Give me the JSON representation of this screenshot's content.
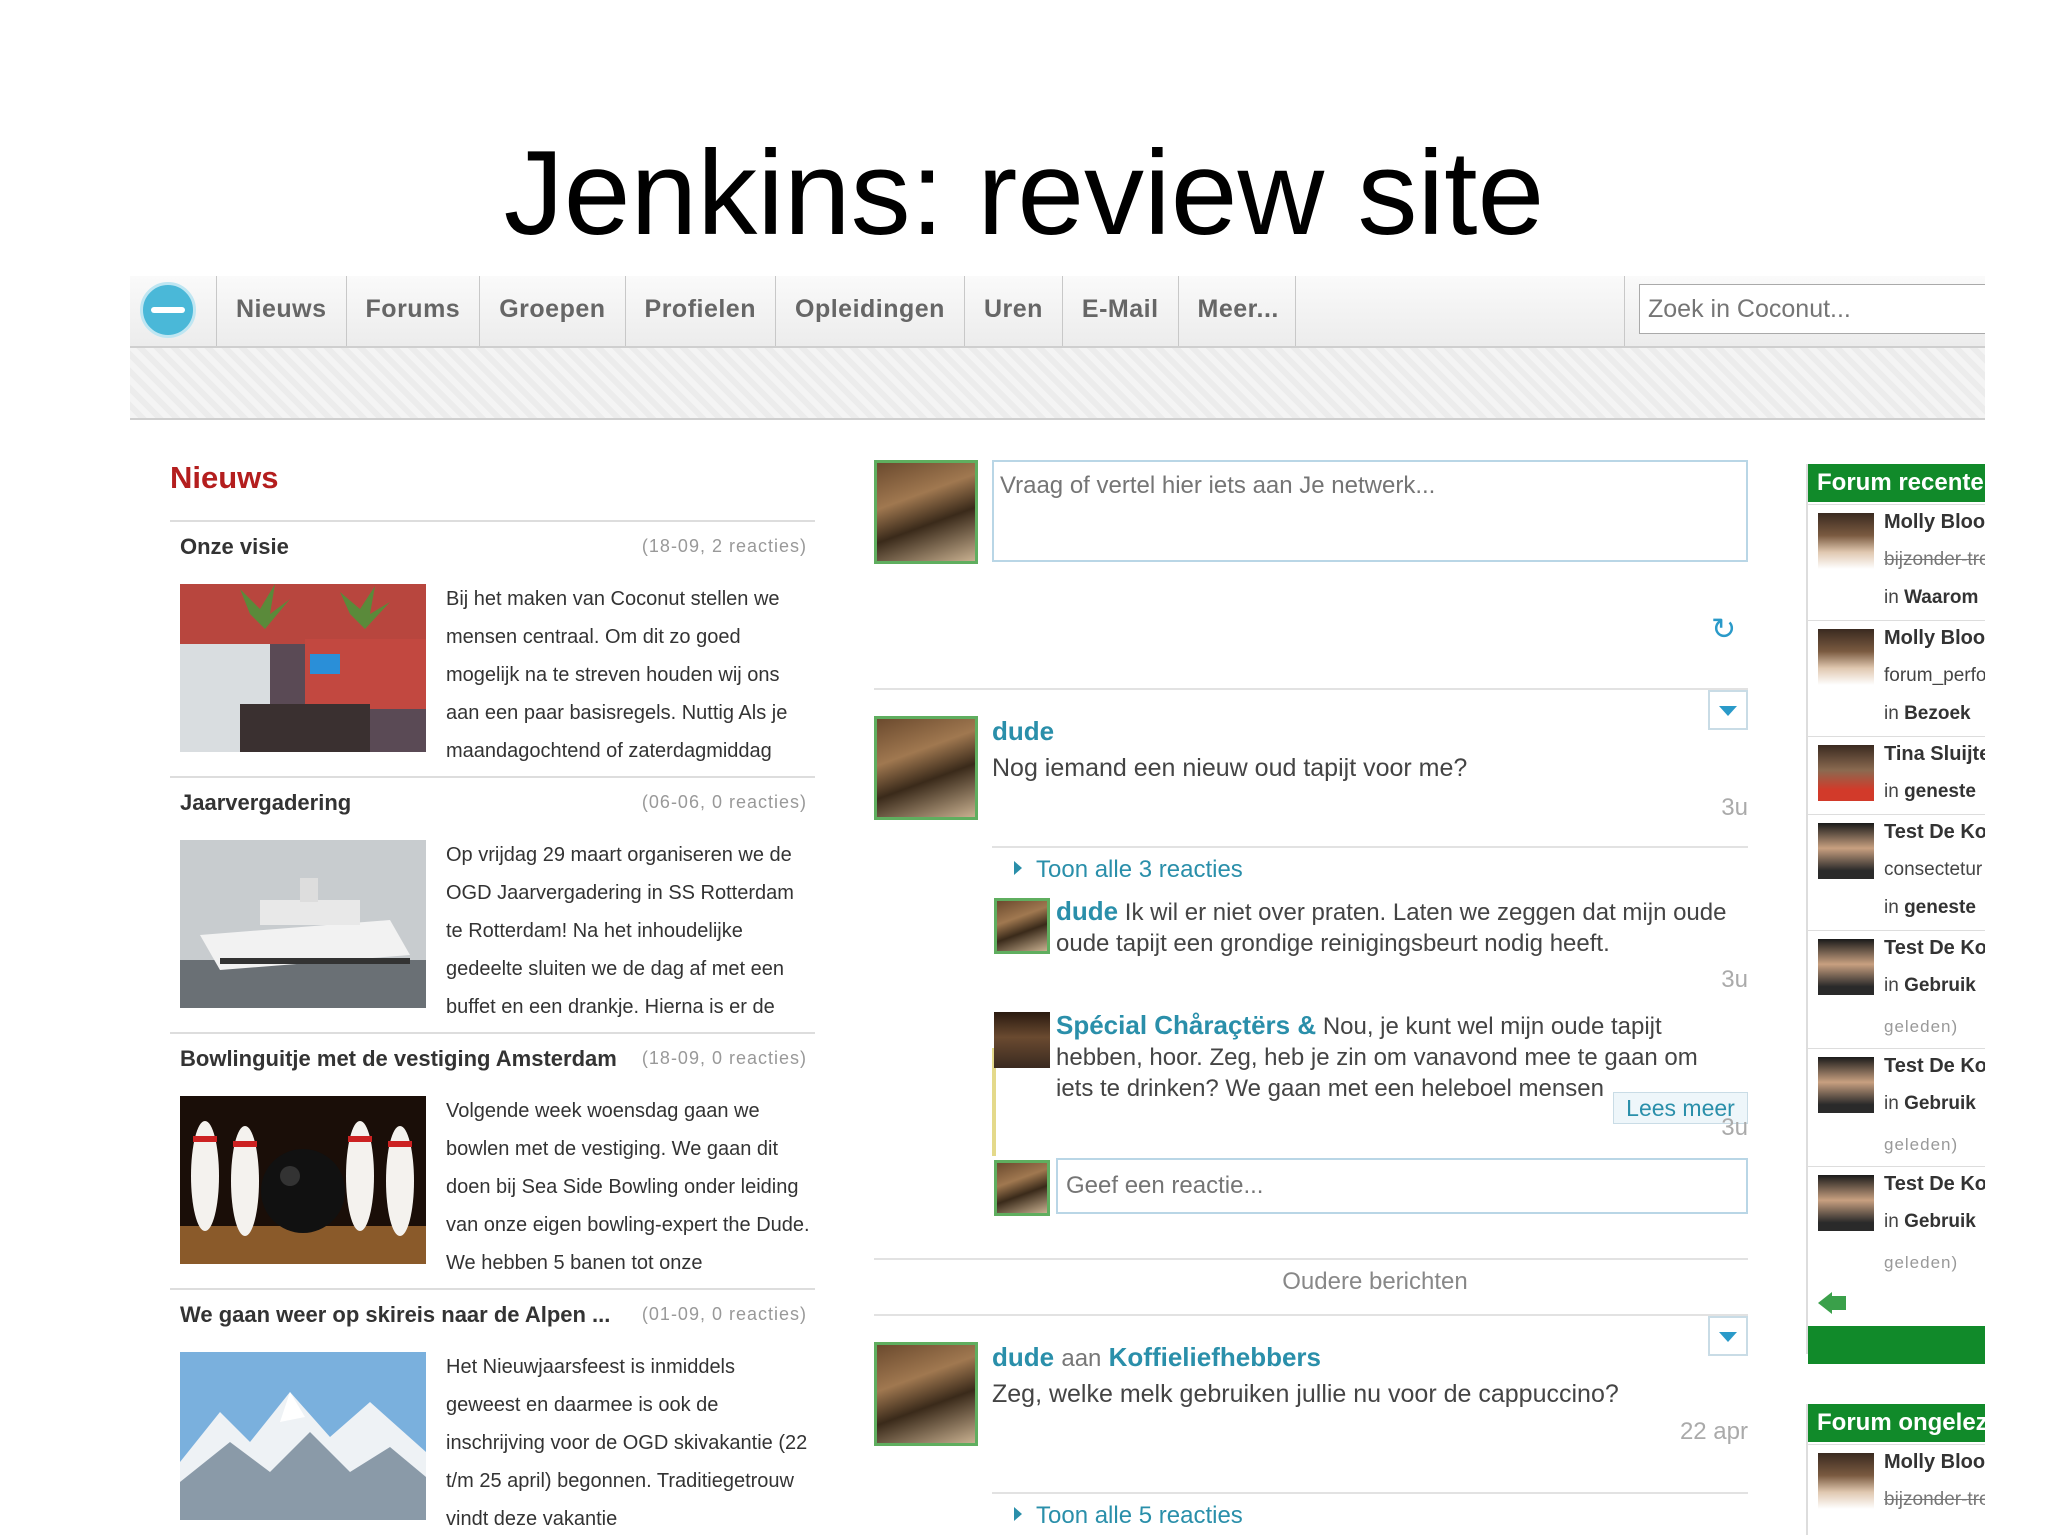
{
  "slide": {
    "title": "Jenkins: review site"
  },
  "nav": {
    "items": [
      "Nieuws",
      "Forums",
      "Groepen",
      "Profielen",
      "Opleidingen",
      "Uren",
      "E-Mail",
      "Meer..."
    ],
    "search_placeholder": "Zoek in Coconut..."
  },
  "news": {
    "title": "Nieuws",
    "items": [
      {
        "title": "Onze visie",
        "meta": "(18-09, 2 reacties)",
        "text": "Bij het maken van Coconut stellen we mensen centraal. Om dit zo goed mogelijk na te streven houden wij ons aan een paar basisregels. Nuttig Als je maandagochtend of zaterdagmiddag"
      },
      {
        "title": "Jaarvergadering",
        "meta": "(06-06, 0 reacties)",
        "text": "Op vrijdag 29 maart organiseren we de OGD Jaarvergadering in SS Rotterdam te Rotterdam! Na het inhoudelijke gedeelte sluiten we de dag af met een buffet en een drankje. Hierna is er de"
      },
      {
        "title": "Bowlinguitje met de vestiging Amsterdam",
        "meta": "(18-09, 0 reacties)",
        "text": "Volgende week woensdag gaan we bowlen met de vestiging. We gaan dit doen bij Sea Side Bowling onder leiding van onze eigen bowling-expert the Dude. We hebben 5 banen tot onze"
      },
      {
        "title": "We gaan weer op skireis naar de Alpen ...",
        "meta": "(01-09, 0 reacties)",
        "text": "Het Nieuwjaarsfeest is inmiddels geweest en daarmee is ook de inschrijving voor de OGD skivakantie (22 t/m 25 april) begonnen. Traditiegetrouw vindt deze vakantie"
      }
    ]
  },
  "feed": {
    "input_placeholder": "Vraag of vertel hier iets aan Je netwerk...",
    "post1": {
      "author": "dude",
      "message": "Nog iemand een nieuw oud tapijt voor me?",
      "time": "3u",
      "toggle": "Toon alle 3 reacties",
      "reply1": {
        "author": "dude",
        "text": "Ik wil er niet over praten. Laten we zeggen dat mijn oude oude tapijt een grondige reinigingsbeurt nodig heeft.",
        "time": "3u"
      },
      "reply2": {
        "author": "Spécial Chåraçtërs &",
        "text": "Nou, je kunt wel mijn oude tapijt hebben, hoor. Zeg, heb je zin om vanavond mee te gaan om iets te drinken? We gaan met een heleboel mensen",
        "more": "Lees meer",
        "time": "3u"
      },
      "reply_placeholder": "Geef een reactie..."
    },
    "older": "Oudere berichten",
    "post2": {
      "author": "dude",
      "connector": "aan",
      "group": "Koffieliefhebbers",
      "message": "Zeg, welke melk gebruiken jullie nu voor de cappuccino?",
      "time": "22 apr",
      "toggle": "Toon alle 5 reacties"
    }
  },
  "forum": {
    "recent_title": "Forum recente",
    "entries": [
      {
        "name": "Molly Bloo",
        "line1": "bijzonder-tre",
        "line1_strike": true,
        "prefix": "in",
        "place": "Waarom"
      },
      {
        "name": "Molly Bloo",
        "line1": "forum_perfo",
        "prefix": "in",
        "place": "Bezoek"
      },
      {
        "name": "Tina Sluijte",
        "prefix": "in",
        "place": "geneste"
      },
      {
        "name": "Test De Ko",
        "line1": "consectetur",
        "prefix": "in",
        "place": "geneste"
      },
      {
        "name": "Test De Ko",
        "prefix": "in",
        "place": "Gebruik",
        "small": "geleden)"
      },
      {
        "name": "Test De Ko",
        "prefix": "in",
        "place": "Gebruik",
        "small": "geleden)"
      },
      {
        "name": "Test De Ko",
        "prefix": "in",
        "place": "Gebruik",
        "small": "geleden)"
      }
    ],
    "unread_title": "Forum ongelez",
    "unread_entry": {
      "name": "Molly Bloo",
      "line1": "bijzonder-tre"
    },
    "colors": {
      "header": "#118a2a",
      "accent": "#2a8faa",
      "news_title": "#b41e1e"
    }
  }
}
